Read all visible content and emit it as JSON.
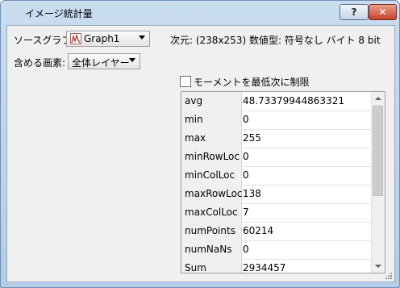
{
  "window": {
    "title": "イメージ統計量",
    "help_label": "?",
    "close_label": "✕"
  },
  "source": {
    "label": "ソースグラフ:",
    "value": "Graph1"
  },
  "dims": {
    "text": "次元: (238x253) 数値型: 符号なし バイト 8 bit"
  },
  "include": {
    "label": "含める画素:",
    "value": "全体レイヤー"
  },
  "moment": {
    "label": "モーメントを最低次に制限",
    "checked": false
  },
  "stats": {
    "rows": [
      {
        "key": "avg",
        "value": "48.73379944863321"
      },
      {
        "key": "min",
        "value": "0"
      },
      {
        "key": "max",
        "value": "255"
      },
      {
        "key": "minRowLoc",
        "value": "0"
      },
      {
        "key": "minColLoc",
        "value": "0"
      },
      {
        "key": "maxRowLoc",
        "value": "138"
      },
      {
        "key": "maxColLoc",
        "value": "7"
      },
      {
        "key": "numPoints",
        "value": "60214"
      },
      {
        "key": "numNaNs",
        "value": "0"
      },
      {
        "key": "Sum",
        "value": "2934457"
      }
    ]
  },
  "colors": {
    "title_bar": "#b4cde8",
    "close_button": "#c5412a",
    "dialog_bg": "#f0f0f0"
  }
}
